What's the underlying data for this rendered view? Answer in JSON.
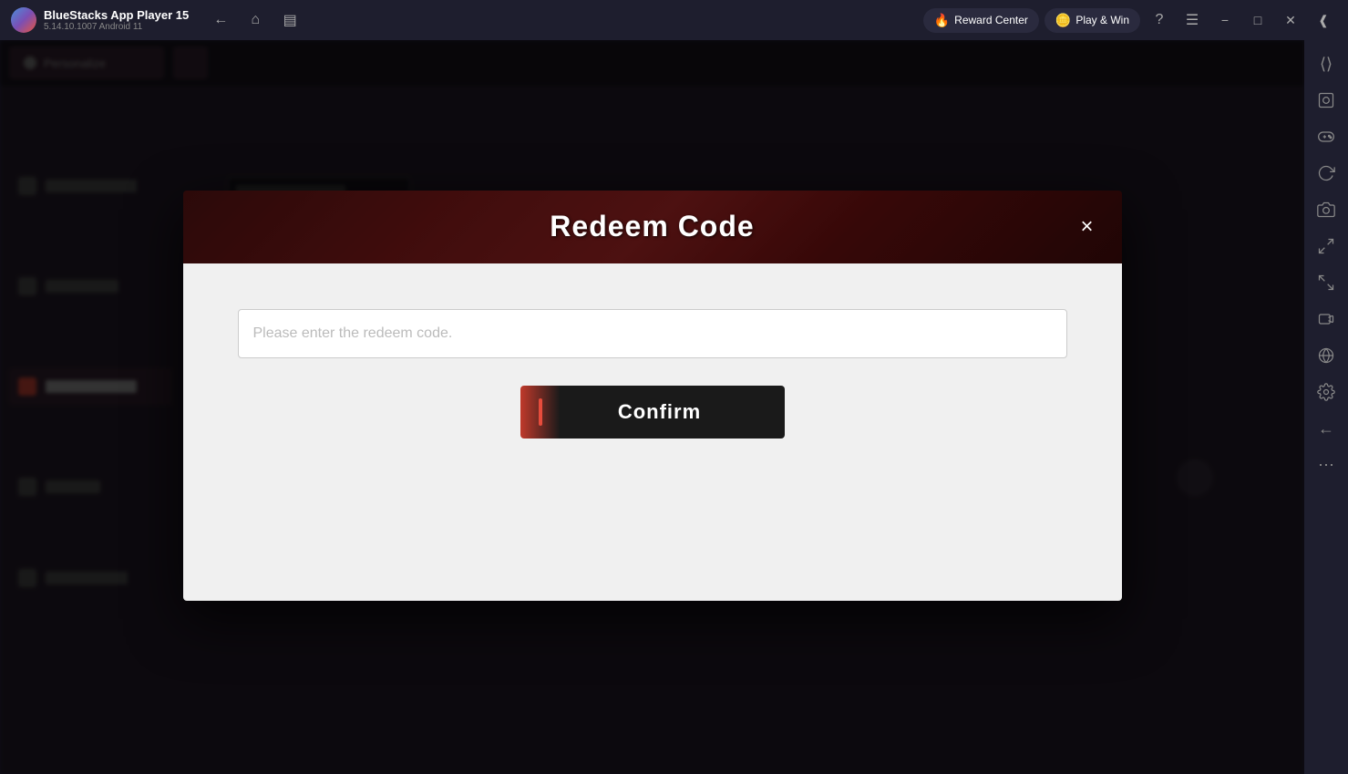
{
  "titleBar": {
    "appName": "BlueStacks App Player 15",
    "version": "5.14.10.1007  Android 11",
    "rewardCenter": "Reward Center",
    "playWin": "Play & Win"
  },
  "modal": {
    "title": "Redeem Code",
    "closeLabel": "×",
    "input": {
      "placeholder": "Please enter the redeem code.",
      "value": ""
    },
    "confirmButton": "Confirm"
  },
  "rightSidebar": {
    "icons": [
      "⬡",
      "📷",
      "🎮",
      "🔄",
      "📸",
      "↔",
      "↕",
      "📋",
      "🌐",
      "⚙",
      "←",
      "⋯"
    ]
  }
}
